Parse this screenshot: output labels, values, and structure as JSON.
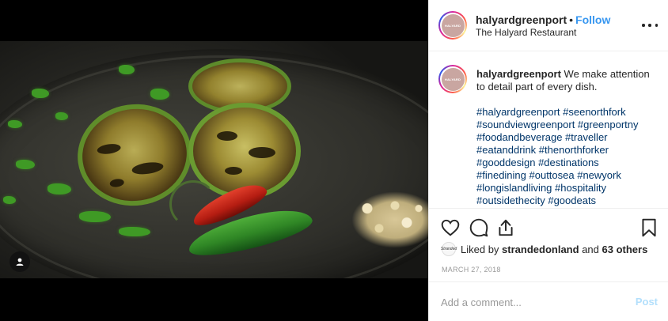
{
  "post": {
    "photo_alt": "",
    "account": {
      "username": "halyardgreenport",
      "follow_label": "Follow",
      "location": "The Halyard Restaurant",
      "avatar_logo_text": "HALYARD"
    },
    "caption": {
      "text": "We make attention to detail part of every dish.",
      "hashtags": [
        "#halyardgreenport #seenorthfork",
        "#soundviewgreenport #greenportny",
        "#foodandbeverage #traveller",
        "#eatanddrink #thenorthforker",
        "#gooddesign #destinations",
        "#finedining #outtosea #newyork",
        "#longislandliving #hospitality",
        "#outsidethecity #goodeats"
      ]
    },
    "likes": {
      "liked_by_prefix": "Liked by",
      "liked_by_user": "strandedonland",
      "and_text": "and",
      "others_count": "63 others",
      "mini_avatar_text": "Stranded"
    },
    "date": "MARCH 27, 2018",
    "comment": {
      "placeholder": "Add a comment...",
      "post_label": "Post"
    },
    "icons": [
      "heart-icon",
      "comment-icon",
      "share-icon",
      "bookmark-icon",
      "more-options-icon",
      "user-tag-icon"
    ]
  }
}
